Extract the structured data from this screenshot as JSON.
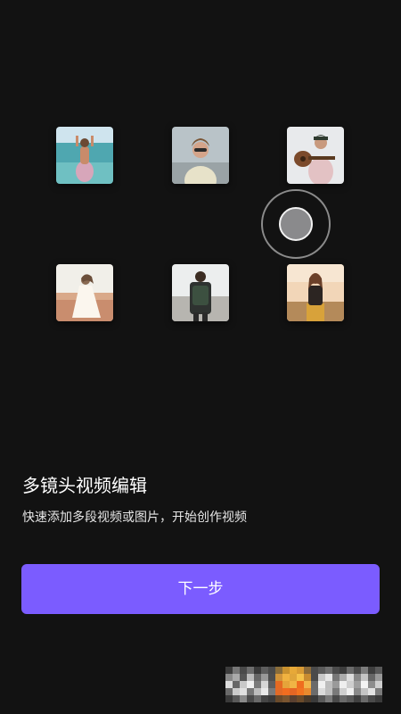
{
  "gallery": {
    "items": [
      {
        "id": "beach",
        "icon": "photo-thumbnail"
      },
      {
        "id": "sunglasses",
        "icon": "photo-thumbnail"
      },
      {
        "id": "guitar",
        "icon": "photo-thumbnail"
      },
      {
        "id": "field-dress",
        "icon": "photo-thumbnail"
      },
      {
        "id": "backpack",
        "icon": "photo-thumbnail"
      },
      {
        "id": "sunset-field",
        "icon": "photo-thumbnail"
      }
    ]
  },
  "intro": {
    "title": "多镜头视频编辑",
    "subtitle": "快速添加多段视频或图片，开始创作视频"
  },
  "actions": {
    "next_label": "下一步"
  },
  "colors": {
    "background": "#121212",
    "accent": "#7b5cff",
    "text_primary": "#ffffff"
  }
}
